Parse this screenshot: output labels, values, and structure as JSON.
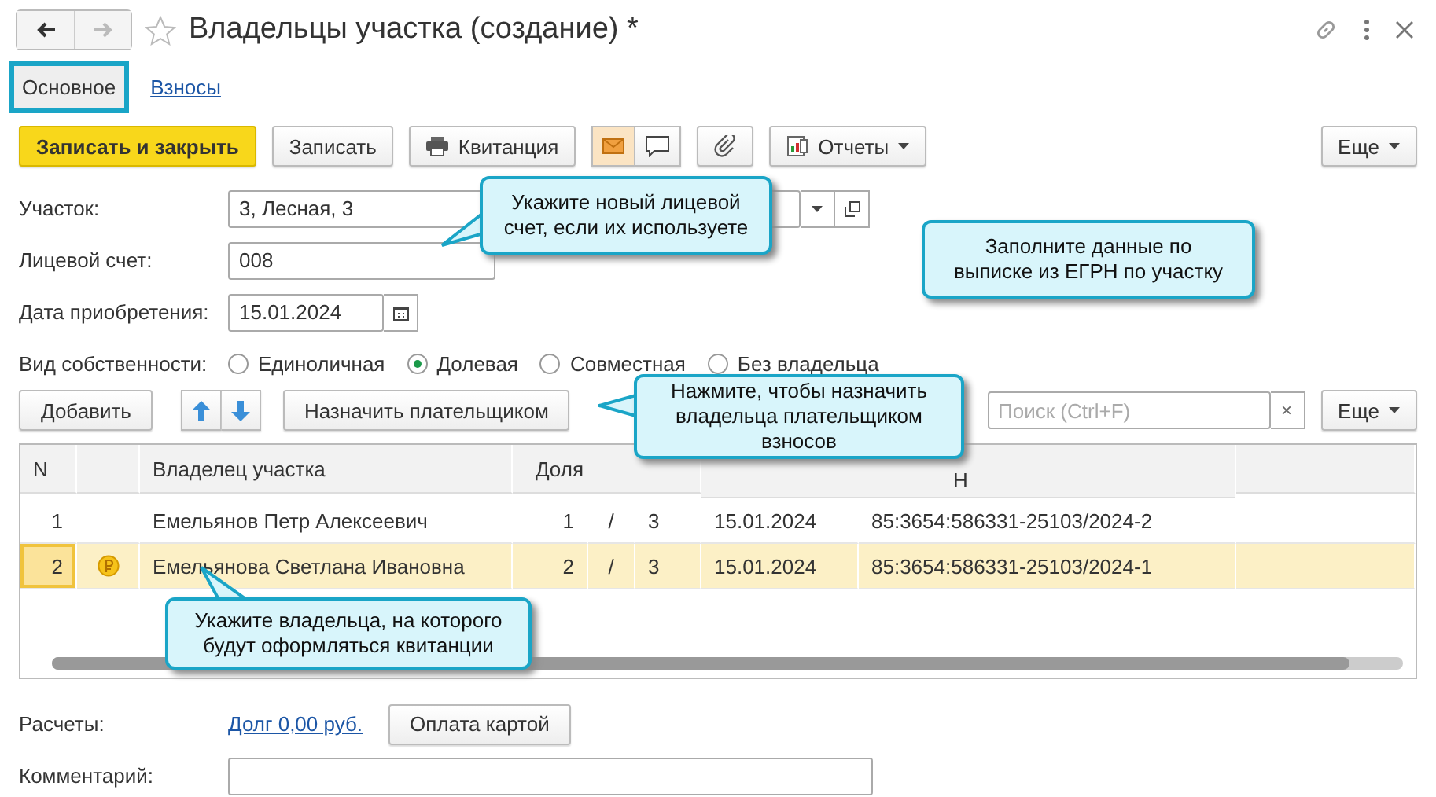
{
  "window": {
    "title": "Владельцы участка (создание) *"
  },
  "tabs": [
    {
      "label": "Основное",
      "selected": true
    },
    {
      "label": "Взносы",
      "selected": false
    }
  ],
  "toolbar": {
    "buttons": [
      {
        "kind": "primary",
        "label": "Записать и закрыть"
      },
      {
        "kind": "plain",
        "label": "Записать"
      },
      {
        "kind": "printer",
        "label": "Квитанция"
      },
      {
        "kind": "envelope"
      },
      {
        "kind": "comment"
      },
      {
        "kind": "clip"
      },
      {
        "kind": "report",
        "label": "Отчеты"
      }
    ],
    "more": "Еще"
  },
  "fields": {
    "plot": {
      "label": "Участок:",
      "value": "3, Лесная, 3"
    },
    "account": {
      "label": "Лицевой счет:",
      "value": "008"
    },
    "date": {
      "label": "Дата приобретения:",
      "value": "15.01.2024"
    }
  },
  "ownership": {
    "label": "Вид собственности:",
    "options": [
      {
        "label": "Единоличная",
        "selected": false
      },
      {
        "label": "Долевая",
        "selected": true
      },
      {
        "label": "Совместная",
        "selected": false
      },
      {
        "label": "Без владельца",
        "selected": false
      }
    ]
  },
  "table_toolbar": {
    "add": "Добавить",
    "assign": "Назначить плательщиком",
    "search_placeholder": "Поиск (Ctrl+F)",
    "clear": "×",
    "more": "Еще"
  },
  "table": {
    "columns": [
      "N",
      "Владелец участка",
      "Доля",
      "Н"
    ],
    "rows": [
      {
        "n": "1",
        "payer": false,
        "owner": "Емельянов Петр Алексеевич",
        "share_num": "1",
        "share_sep": "/",
        "share_den": "3",
        "date": "15.01.2024",
        "record": "85:3654:586331-25103/2024-2",
        "selected": false
      },
      {
        "n": "2",
        "payer": true,
        "owner": "Емельянова Светлана Ивановна",
        "share_num": "2",
        "share_sep": "/",
        "share_den": "3",
        "date": "15.01.2024",
        "record": "85:3654:586331-25103/2024-1",
        "selected": true
      }
    ]
  },
  "payments": {
    "label": "Расчеты:",
    "link": "Долг 0,00 руб.",
    "button": "Оплата картой"
  },
  "comment": {
    "label": "Комментарий:"
  },
  "callouts": [
    {
      "text": "Укажите новый лицевой счет, если их используете"
    },
    {
      "text": "Заполните данные по выписке из ЕГРН по участку"
    },
    {
      "text": "Нажмите, чтобы назначить владельца плательщиком взносов"
    },
    {
      "text": "Укажите владельца, на которого будут оформляться квитанции"
    }
  ]
}
